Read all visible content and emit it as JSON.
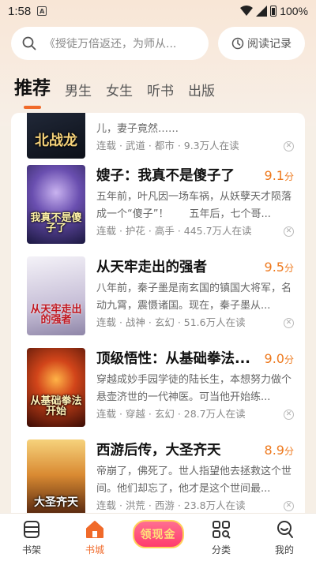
{
  "status_bar": {
    "time": "1:58",
    "battery": "100%"
  },
  "search": {
    "placeholder": "《授徒万倍返还，为师从...",
    "history_label": "阅读记录"
  },
  "tabs": [
    {
      "label": "推荐",
      "active": true
    },
    {
      "label": "男生",
      "active": false
    },
    {
      "label": "女生",
      "active": false
    },
    {
      "label": "听书",
      "active": false
    },
    {
      "label": "出版",
      "active": false
    }
  ],
  "books": [
    {
      "title": "",
      "score": "",
      "desc": "儿，妻子竟然……",
      "meta": "连载 · 武道 · 都市 · 9.3万人在读",
      "cover_title": "北战龙",
      "cover_colors": [
        "#1a2333",
        "#0c1018"
      ]
    },
    {
      "title": "嫂子：我真不是傻子了",
      "score": "9.1",
      "desc": "五年前，叶凡因一场车祸，从妖孽天才陨落成一个“傻子”！　　五年后，七个哥...",
      "meta": "连载 · 护花 · 高手 · 445.7万人在读",
      "cover_title": "我真不是傻子了",
      "cover_colors": [
        "#4a3c8c",
        "#1b1840"
      ]
    },
    {
      "title": "从天牢走出的强者",
      "score": "9.5",
      "desc": "八年前，秦子墨是南玄国的镇国大将军，名动九霄，震慑诸国。现在，秦子墨从...",
      "meta": "连载 · 战神 · 玄幻 · 51.6万人在读",
      "cover_title": "从天牢走出的强者",
      "cover_colors": [
        "#e9e6ef",
        "#b9b2c8"
      ]
    },
    {
      "title": "顶级悟性：从基础拳法...",
      "score": "9.0",
      "desc": "穿越成妙手园学徒的陆长生，本想努力做个悬壶济世的一代神医。可当他开始练...",
      "meta": "连载 · 穿越 · 玄幻 · 28.7万人在读",
      "cover_title": "从基础拳法开始",
      "cover_colors": [
        "#c23a12",
        "#2a0a04"
      ]
    },
    {
      "title": "西游后传，大圣齐天",
      "score": "8.9",
      "desc": "帝崩了，佛死了。世人指望他去拯救这个世间。他们却忘了，他才是这个世间最...",
      "meta": "连载 · 洪荒 · 西游 · 23.8万人在读",
      "cover_title": "大圣齐天",
      "cover_colors": [
        "#e8b45a",
        "#5a2a12"
      ]
    }
  ],
  "score_unit": "分",
  "bottom_nav": [
    {
      "label": "书架",
      "active": false,
      "icon": "bookshelf-icon"
    },
    {
      "label": "书城",
      "active": true,
      "icon": "home-icon"
    },
    {
      "label": "领现金",
      "promo": true
    },
    {
      "label": "分类",
      "active": false,
      "icon": "category-icon"
    },
    {
      "label": "我的",
      "active": false,
      "icon": "profile-icon"
    }
  ],
  "colors": {
    "accent": "#f06a2a",
    "score": "#ee7a1f"
  }
}
